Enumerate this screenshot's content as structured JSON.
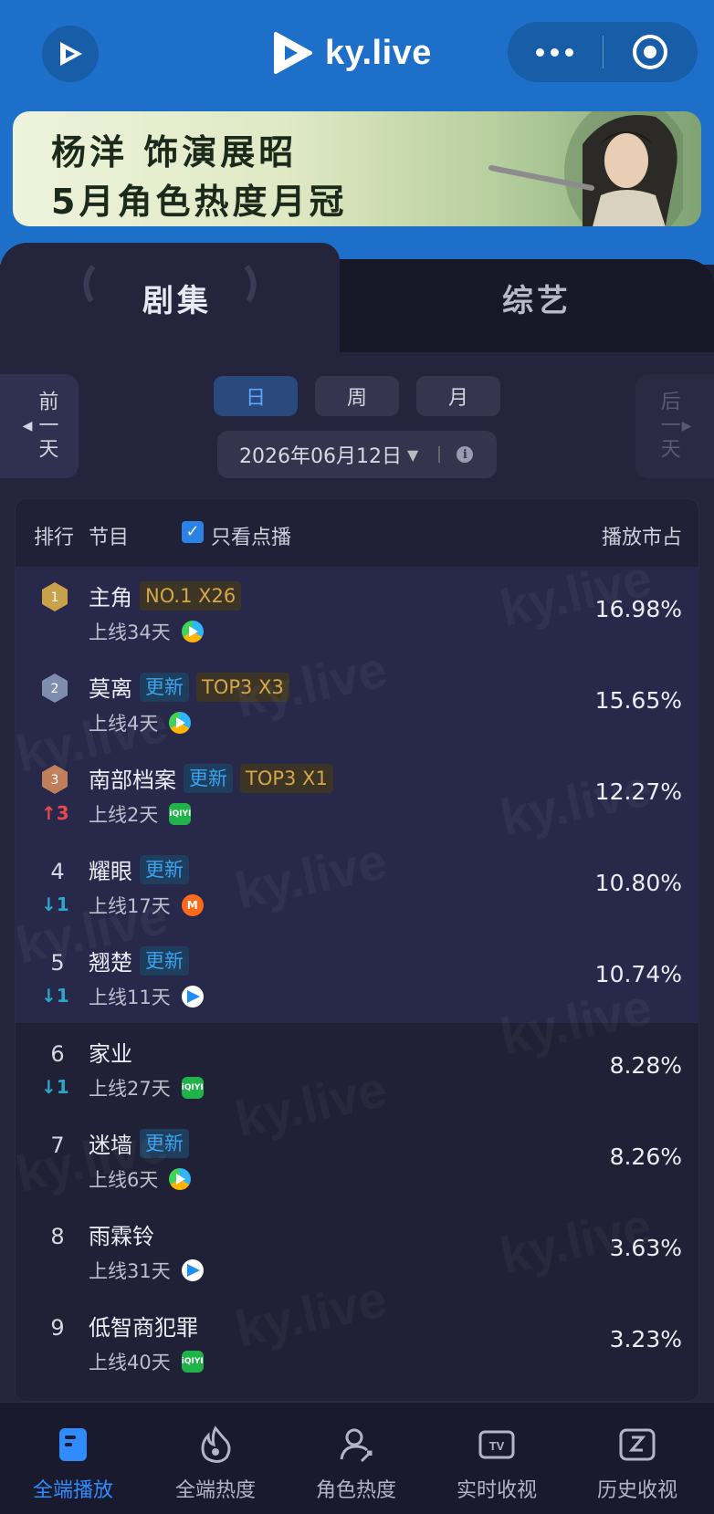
{
  "header": {
    "brand": "ky.live",
    "banner_line1": "杨洋 饰演展昭",
    "banner_line2": "5月角色热度月冠"
  },
  "tabs": [
    {
      "label": "剧集",
      "active": true
    },
    {
      "label": "综艺",
      "active": false
    }
  ],
  "nav_buttons": {
    "prev": "前一天",
    "next": "后一天"
  },
  "periods": [
    {
      "label": "日",
      "active": true
    },
    {
      "label": "周",
      "active": false
    },
    {
      "label": "月",
      "active": false
    }
  ],
  "date": "2026年06月12日",
  "table": {
    "col_rank": "排行",
    "col_program": "节目",
    "filter_label": "只看点播",
    "filter_checked": true,
    "col_share": "播放市占",
    "rows": [
      {
        "rank": "1",
        "title": "主角",
        "tags": [
          {
            "text": "NO.1 X26",
            "kind": "gold"
          }
        ],
        "days": "上线34天",
        "platform": "tencent",
        "change": "",
        "share": "16.98%"
      },
      {
        "rank": "2",
        "title": "莫离",
        "tags": [
          {
            "text": "更新",
            "kind": "upd"
          },
          {
            "text": "TOP3 X3",
            "kind": "gold"
          }
        ],
        "days": "上线4天",
        "platform": "tencent",
        "change": "",
        "share": "15.65%"
      },
      {
        "rank": "3",
        "title": "南部档案",
        "tags": [
          {
            "text": "更新",
            "kind": "upd"
          },
          {
            "text": "TOP3 X1",
            "kind": "gold"
          }
        ],
        "days": "上线2天",
        "platform": "iqiyi",
        "change": "↑3",
        "change_dir": "up",
        "share": "12.27%"
      },
      {
        "rank": "4",
        "title": "耀眼",
        "tags": [
          {
            "text": "更新",
            "kind": "upd"
          }
        ],
        "days": "上线17天",
        "platform": "mango",
        "change": "↓1",
        "change_dir": "down",
        "share": "10.80%"
      },
      {
        "rank": "5",
        "title": "翘楚",
        "tags": [
          {
            "text": "更新",
            "kind": "upd"
          }
        ],
        "days": "上线11天",
        "platform": "youku",
        "change": "↓1",
        "change_dir": "down",
        "share": "10.74%"
      },
      {
        "rank": "6",
        "title": "家业",
        "tags": [],
        "days": "上线27天",
        "platform": "iqiyi",
        "change": "↓1",
        "change_dir": "down",
        "share": "8.28%"
      },
      {
        "rank": "7",
        "title": "迷墙",
        "tags": [
          {
            "text": "更新",
            "kind": "upd"
          }
        ],
        "days": "上线6天",
        "platform": "tencent",
        "change": "",
        "share": "8.26%"
      },
      {
        "rank": "8",
        "title": "雨霖铃",
        "tags": [],
        "days": "上线31天",
        "platform": "youku",
        "change": "",
        "share": "3.63%"
      },
      {
        "rank": "9",
        "title": "低智商犯罪",
        "tags": [],
        "days": "上线40天",
        "platform": "iqiyi",
        "change": "",
        "share": "3.23%"
      }
    ]
  },
  "bottom_nav": [
    {
      "label": "全端播放",
      "icon": "document-icon",
      "active": true
    },
    {
      "label": "全端热度",
      "icon": "flame-icon",
      "active": false
    },
    {
      "label": "角色热度",
      "icon": "person-icon",
      "active": false
    },
    {
      "label": "实时收视",
      "icon": "tv-icon",
      "active": false
    },
    {
      "label": "历史收视",
      "icon": "history-icon",
      "active": false
    }
  ],
  "colors": {
    "header_blue": "#1d6fc9",
    "accent_blue": "#2f8cff",
    "update_tag": "#3aa4f0",
    "gold_tag": "#d6a64a",
    "rank_up": "#e5484d",
    "rank_down": "#2aa7c9"
  }
}
